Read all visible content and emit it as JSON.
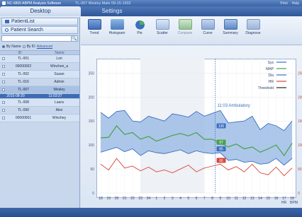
{
  "window": {
    "title": "NC-6800 ABPM Analysis Software",
    "info": "TL-007    Wesley    Male    09-15-1932",
    "right_items": [
      "Print",
      "Help"
    ]
  },
  "top_tabs": [
    {
      "label": "Desktop",
      "active": true
    },
    {
      "label": "Settings",
      "active": false
    }
  ],
  "sidebar": {
    "patient_list_label": "PatientList",
    "patient_search_label": "Patient Search",
    "search_value": "",
    "radio_by_name": "By Name",
    "radio_by_id": "By ID",
    "advanced_label": "Advanced",
    "columns": [
      "ID",
      "Name"
    ],
    "patients": [
      {
        "id": "TL-001",
        "name": "Lori"
      },
      {
        "id": "00000002",
        "name": "Winchen_a"
      },
      {
        "id": "TL-002",
        "name": "Susan"
      },
      {
        "id": "TL-016",
        "name": "Admin"
      },
      {
        "id": "TL-007",
        "name": "Wesley",
        "selected": true
      },
      {
        "id": "2015-08-20",
        "name": "11:03:27",
        "sub": true
      },
      {
        "id": "TL-008",
        "name": "Laura"
      },
      {
        "id": "TL-090",
        "name": "Alex"
      },
      {
        "id": "00000001",
        "name": "Winchey"
      }
    ]
  },
  "toolbar": {
    "buttons": [
      {
        "label": "Trend",
        "icon": "trend-chart-icon",
        "active": true
      },
      {
        "label": "Histogram",
        "icon": "histogram-icon"
      },
      {
        "label": "Pie",
        "icon": "pie-chart-icon"
      },
      {
        "label": "Scatter",
        "icon": "scatter-plot-icon"
      },
      {
        "label": "Compare",
        "icon": "compare-icon",
        "dim": true
      },
      {
        "label": "Curve",
        "icon": "curve-icon"
      },
      {
        "label": "Summary",
        "icon": "summary-icon"
      },
      {
        "label": "Diagnose",
        "icon": "diagnose-icon"
      }
    ]
  },
  "chart_data": {
    "type": "line",
    "title": "",
    "annotation": "11:03 Ambulatory",
    "x": [
      "18",
      "19",
      "20",
      "21",
      "22",
      "23",
      "24",
      "1",
      "2",
      "3",
      "4",
      "5",
      "6",
      "7",
      "8",
      "9",
      "10",
      "11",
      "12",
      "13",
      "14",
      "15",
      "16",
      "17",
      "18"
    ],
    "xlabel": "",
    "ylabel": "",
    "y_ticks_left": [
      "0",
      "50",
      "100",
      "150",
      "200",
      "250"
    ],
    "y_ticks_right": [
      "0",
      "50",
      "100",
      "150",
      "200",
      "250"
    ],
    "ylim": [
      0,
      280
    ],
    "legend_placement": "top-right",
    "legend": [
      "Sys",
      "MAP",
      "Dia",
      "HR",
      "Threshold"
    ],
    "series": [
      {
        "name": "Sys",
        "color": "#3b6fc1",
        "values": [
          168,
          156,
          170,
          172,
          150,
          148,
          160,
          155,
          150,
          165,
          162,
          158,
          170,
          160,
          166,
          172,
          146,
          148,
          150,
          160,
          132,
          145,
          140,
          130,
          150
        ]
      },
      {
        "name": "MAP",
        "color": "#4aa04a",
        "values": [
          115,
          116,
          140,
          122,
          126,
          112,
          118,
          108,
          114,
          120,
          124,
          119,
          126,
          112,
          112,
          104,
          96,
          102,
          92,
          96,
          85,
          92,
          100,
          78,
          104
        ]
      },
      {
        "name": "Dia",
        "color": "#3b6fc1",
        "values": [
          85,
          90,
          95,
          86,
          92,
          78,
          88,
          84,
          82,
          86,
          90,
          82,
          88,
          84,
          82,
          84,
          68,
          70,
          64,
          66,
          60,
          62,
          72,
          58,
          72
        ]
      },
      {
        "name": "HR",
        "color": "#d9463c",
        "values": [
          60,
          48,
          72,
          52,
          56,
          46,
          54,
          44,
          48,
          42,
          50,
          58,
          44,
          52,
          56,
          60,
          48,
          55,
          44,
          60,
          42,
          38,
          54,
          36,
          52
        ]
      }
    ],
    "markers": [
      {
        "label": "135",
        "color": "#3b6fc1"
      },
      {
        "label": "97",
        "color": "#4aa04a"
      },
      {
        "label": "85",
        "color": "#3b6fc1"
      },
      {
        "label": "66",
        "color": "#d9463c"
      }
    ],
    "grid": true
  },
  "bottom": {
    "left_label": "HR",
    "right_label": "BPM"
  }
}
